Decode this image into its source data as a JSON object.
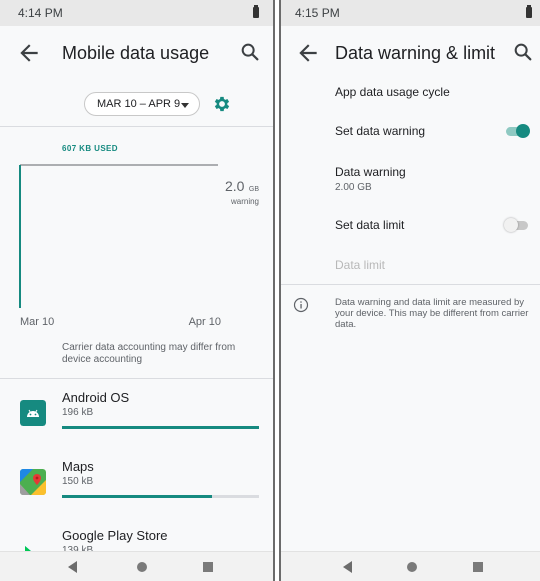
{
  "left": {
    "status_time": "4:14 PM",
    "title": "Mobile data usage",
    "cycle_label": "MAR 10 – APR 9",
    "usage_label": "607 KB USED",
    "warning_value": "2.0",
    "warning_unit": "GB",
    "warning_label": "warning",
    "x_start": "Mar 10",
    "x_end": "Apr 10",
    "note": "Carrier data accounting may differ from device accounting",
    "apps": [
      {
        "name": "Android OS",
        "size": "196 kB",
        "usage_fraction": 1.0,
        "icon": "android-os-icon",
        "icon_color": "#168a80"
      },
      {
        "name": "Maps",
        "size": "150 kB",
        "usage_fraction": 0.76,
        "icon": "maps-icon",
        "icon_color": "#4caf50"
      },
      {
        "name": "Google Play Store",
        "size": "139 kB",
        "usage_fraction": null,
        "icon": "play-store-icon",
        "icon_color": "#00b0ff"
      }
    ]
  },
  "right": {
    "status_time": "4:15 PM",
    "title": "Data warning & limit",
    "items": {
      "cycle": "App data usage cycle",
      "set_warning": "Set data warning",
      "warning": "Data warning",
      "warning_value": "2.00 GB",
      "set_limit": "Set data limit",
      "limit": "Data limit"
    },
    "set_warning_on": true,
    "set_limit_on": false,
    "info_text": "Data warning and data limit are measured by your device. This may be different from carrier data."
  },
  "colors": {
    "accent": "#168a80",
    "background": "#f8f9fa",
    "divider": "#dadce0",
    "text_secondary": "#5f6368"
  }
}
